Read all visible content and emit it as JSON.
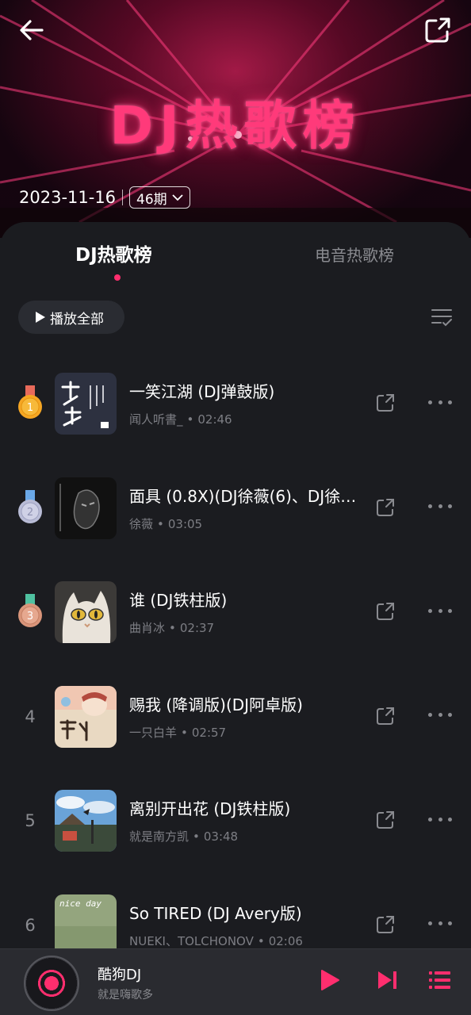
{
  "hero": {
    "title": "DJ热歌榜",
    "date": "2023-11-16",
    "issue": "46期"
  },
  "tabs": [
    {
      "label": "DJ热歌榜",
      "active": true
    },
    {
      "label": "电音热歌榜",
      "active": false
    }
  ],
  "toolbar": {
    "play_all_label": "播放全部"
  },
  "songs": [
    {
      "rank": "1",
      "title": "一笑江湖 (DJ弹鼓版)",
      "artist": "闻人听書_",
      "duration": "02:46",
      "medal": "gold"
    },
    {
      "rank": "2",
      "title": "面具 (0.8X)(DJ徐薇(6)、DJ徐…",
      "artist": "徐薇",
      "duration": "03:05",
      "medal": "silver"
    },
    {
      "rank": "3",
      "title": "谁 (DJ铁柱版)",
      "artist": "曲肖冰",
      "duration": "02:37",
      "medal": "bronze"
    },
    {
      "rank": "4",
      "title": "赐我 (降调版)(DJ阿卓版)",
      "artist": "一只白羊",
      "duration": "02:57",
      "medal": ""
    },
    {
      "rank": "5",
      "title": "离别开出花 (DJ铁柱版)",
      "artist": "就是南方凯",
      "duration": "03:48",
      "medal": ""
    },
    {
      "rank": "6",
      "title": "So TIRED (DJ Avery版)",
      "artist": "NUEKI、TOLCHONOV",
      "duration": "02:06",
      "medal": ""
    }
  ],
  "cover_texts": {
    "song6": "nice day"
  },
  "player": {
    "title": "酷狗DJ",
    "subtitle": "就是嗨歌多"
  },
  "colors": {
    "accent": "#ff2e6e",
    "background": "#1b1c20",
    "gold": "#f5a623",
    "silver": "#b9bcd6",
    "bronze": "#d9957a"
  }
}
